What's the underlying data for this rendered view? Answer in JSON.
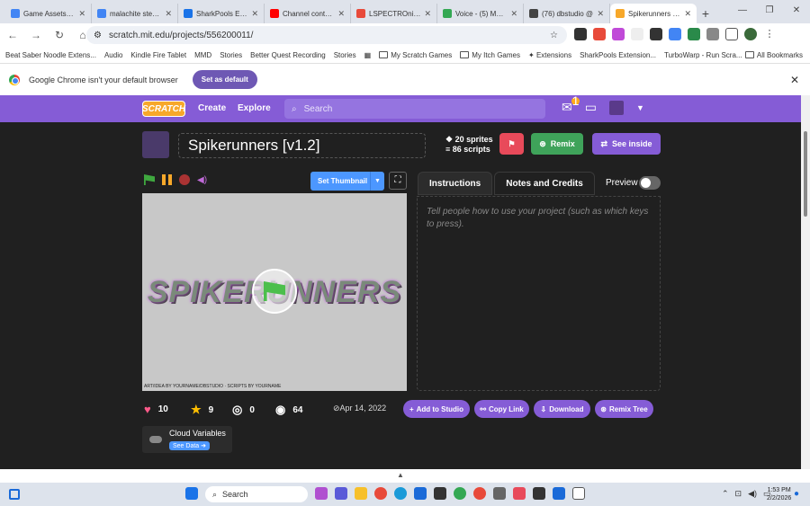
{
  "browser": {
    "tabs": [
      {
        "title": "Game Assets - Ch",
        "color": "#4285f4",
        "active": false
      },
      {
        "title": "malachite steven",
        "color": "#4285f4",
        "active": false
      },
      {
        "title": "SharkPools Exten",
        "color": "#1a73e8",
        "active": false
      },
      {
        "title": "Channel content",
        "color": "#ff0000",
        "active": false
      },
      {
        "title": "LSPECTROnivers",
        "color": "#e84a3a",
        "active": false
      },
      {
        "title": "Voice - (5) Mess",
        "color": "#34a853",
        "active": false
      },
      {
        "title": "(76) dbstudio @",
        "color": "#444444",
        "active": false
      },
      {
        "title": "Spikerunners [v1",
        "color": "#f7a82a",
        "active": true
      }
    ],
    "new_tab": "+",
    "url": "scratch.mit.edu/projects/556200011/",
    "bookmarks": [
      "Beat Saber Noodle Extens...",
      "Audio",
      "Kindle Fire Tablet",
      "MMD",
      "Stories",
      "Better Quest Recording",
      "Stories",
      "My Scratch Games",
      "My Itch Games",
      "Extensions",
      "SharkPools Extension...",
      "TurboWarp - Run Scra..."
    ],
    "all_bookmarks": "All Bookmarks",
    "infobar_text": "Google Chrome isn't your default browser",
    "set_default": "Set as default"
  },
  "scratch_nav": {
    "logo": "SCRATCH",
    "create": "Create",
    "explore": "Explore",
    "search_placeholder": "Search",
    "messages_count": "1"
  },
  "project": {
    "title": "Spikerunners [v1.2]",
    "sprites": "20 sprites",
    "scripts": "86 scripts",
    "remix": "Remix",
    "see_inside": "See inside",
    "set_thumbnail": "Set Thumbnail",
    "stage_title": "SPIKERUNNERS",
    "stage_credits": "ART/IDEA BY YOURNAME/DBSTUDIO · SCRIPTS BY YOURNAME",
    "tab_instructions": "Instructions",
    "tab_notes": "Notes and Credits",
    "preview": "Preview",
    "instructions_placeholder": "Tell people how to use your project (such as which keys to press).",
    "loves": "10",
    "favorites": "9",
    "remixes": "0",
    "views": "64",
    "date": "Apr 14, 2022",
    "add_to_studio": "Add to Studio",
    "copy_link": "Copy Link",
    "download": "Download",
    "remix_tree": "Remix Tree",
    "cloud_label": "Cloud Variables",
    "see_data": "See Data"
  },
  "taskbar": {
    "search": "Search",
    "time": "1:53 PM",
    "date": "2/2/2026"
  },
  "colors": {
    "scratch_purple": "#855cd6",
    "remix_green": "#3fa35a",
    "blue": "#4c97ff",
    "dark_bg": "#202020"
  }
}
